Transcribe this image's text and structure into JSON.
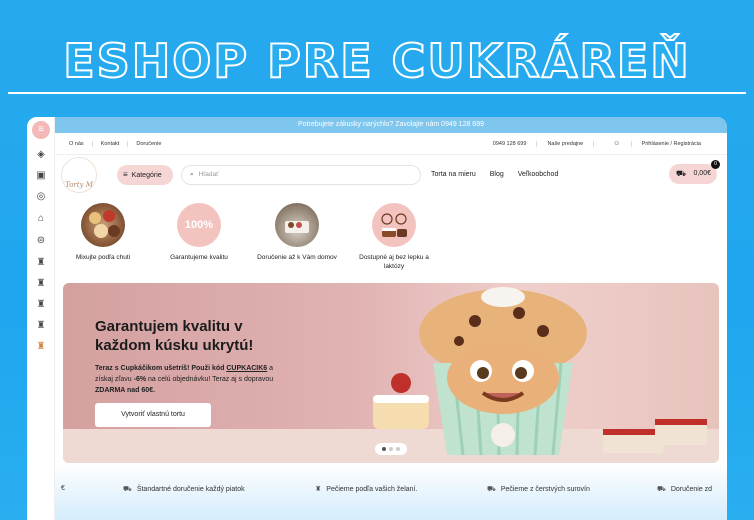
{
  "headline": "ESHOP PRE CUKRÁREŇ",
  "announcement": "Potrebujete zákusky narýchlo? Zavolajte nám 0949 128 699",
  "topbar": {
    "left_links": [
      "O nás",
      "Kontakt",
      "Doručenie"
    ],
    "phone": "0949 128 699",
    "stores": "Naše predajne",
    "login": "Prihlásenie / Registrácia"
  },
  "logo": {
    "text": "Torty M"
  },
  "header": {
    "categories_label": "Kategórie",
    "search_placeholder": "Hľadať",
    "nav": [
      "Torta na mieru",
      "Blog",
      "Veľkoobchod"
    ],
    "cart_amount": "0,00€",
    "cart_count": "0"
  },
  "features": [
    {
      "label": "Mixujte podľa chuti"
    },
    {
      "label": "Garantujeme kvalitu",
      "badge": "100%"
    },
    {
      "label": "Doručenie až k Vám domov"
    },
    {
      "label": "Dostupné aj bez lepku a laktózy"
    }
  ],
  "banner": {
    "title": "Garantujem kvalitu v každom kúsku ukrytú!",
    "text_1": "Teraz s Cupkáčikom ušetríš! Použi kód ",
    "code": "CUPKACIK6",
    "text_2": " a získaj zľavu ",
    "discount": "-6%",
    "text_3": " na celú objednávku! Teraz aj s dopravou ",
    "free": "ZDARMA nad 60€.",
    "button": "Vytvoriť vlastnú tortu"
  },
  "slider": {
    "slides": 3,
    "active": 1
  },
  "social": [
    {
      "icon": "facebook-icon",
      "glyph": "f",
      "color": "#3b5998"
    },
    {
      "icon": "instagram-icon",
      "glyph": "◎",
      "color": "#8a4a3a"
    }
  ],
  "strip": {
    "lead": "€",
    "items": [
      "Štandartné doručenie každý piatok",
      "Pečieme podľa vašich želaní.",
      "Pečieme z čerstvých surovín",
      "Doručenie zd"
    ]
  },
  "colors": {
    "accent_pink": "#f6d5d5",
    "brand_blue": "#27a9ee",
    "announcement_bar": "#7ec6ee"
  }
}
